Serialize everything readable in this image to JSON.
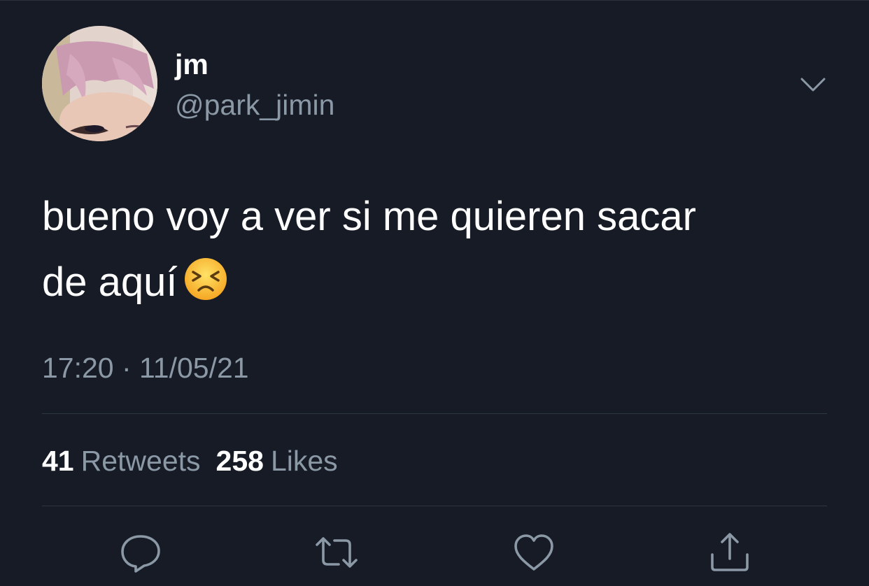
{
  "tweet": {
    "display_name": "jm",
    "handle": "@park_jimin",
    "text_line1": "bueno voy a ver si me quieren sacar",
    "text_line2": "de aquí",
    "emoji": "persevering-face",
    "timestamp": "17:20 · 11/05/21"
  },
  "stats": {
    "retweets_count": "41",
    "retweets_label": "Retweets",
    "likes_count": "258",
    "likes_label": "Likes"
  },
  "actions": [
    "reply-icon",
    "retweet-icon",
    "like-icon",
    "share-icon"
  ],
  "colors": {
    "background": "#161b26",
    "primary_text": "#ffffff",
    "secondary_text": "#8b98a5",
    "divider": "#2e3640",
    "icon": "#8b98a5"
  }
}
